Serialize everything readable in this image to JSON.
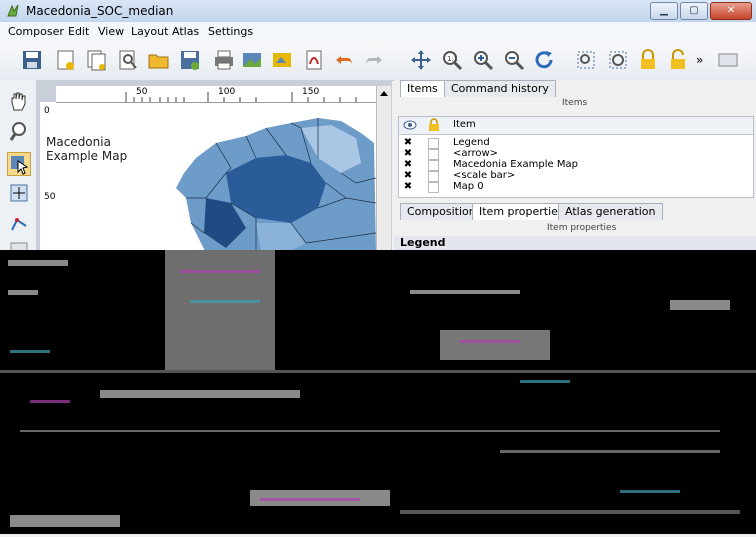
{
  "window": {
    "title": "Macedonia_SOC_median"
  },
  "menu": [
    "Composer",
    "Edit",
    "View",
    "Layout",
    "Atlas",
    "Settings"
  ],
  "toolbar": {
    "icons": [
      "save-icon",
      "new-composer-icon",
      "duplicate-composer-icon",
      "composer-manager-icon",
      "open-template-icon",
      "save-template-icon",
      "print-icon",
      "export-image-icon",
      "export-svg-icon",
      "export-pdf-icon",
      "undo-icon",
      "redo-icon",
      "pan-composer-icon",
      "zoom-full-icon",
      "zoom-in-icon",
      "zoom-out-icon",
      "refresh-icon",
      "select-icon",
      "deselect-icon",
      "lock-icon",
      "unlock-icon",
      "more-icon",
      "atlas-settings-icon"
    ],
    "overflow_label": "»"
  },
  "ruler": {
    "top_labels": [
      "50",
      "100",
      "150"
    ],
    "left_labels": [
      "0",
      "50"
    ]
  },
  "map": {
    "title_line1": "Macedonia",
    "title_line2": "Example Map"
  },
  "panel": {
    "top_tabs": [
      "Items",
      "Command history"
    ],
    "items_section_title": "Items",
    "column_item": "Item",
    "items": [
      "Legend",
      "<arrow>",
      "Macedonia Example Map",
      "<scale bar>",
      "Map 0"
    ],
    "bottom_tabs": [
      "Composition",
      "Item properties",
      "Atlas generation"
    ],
    "properties_section_title": "Item properties",
    "properties_header": "Legend"
  }
}
